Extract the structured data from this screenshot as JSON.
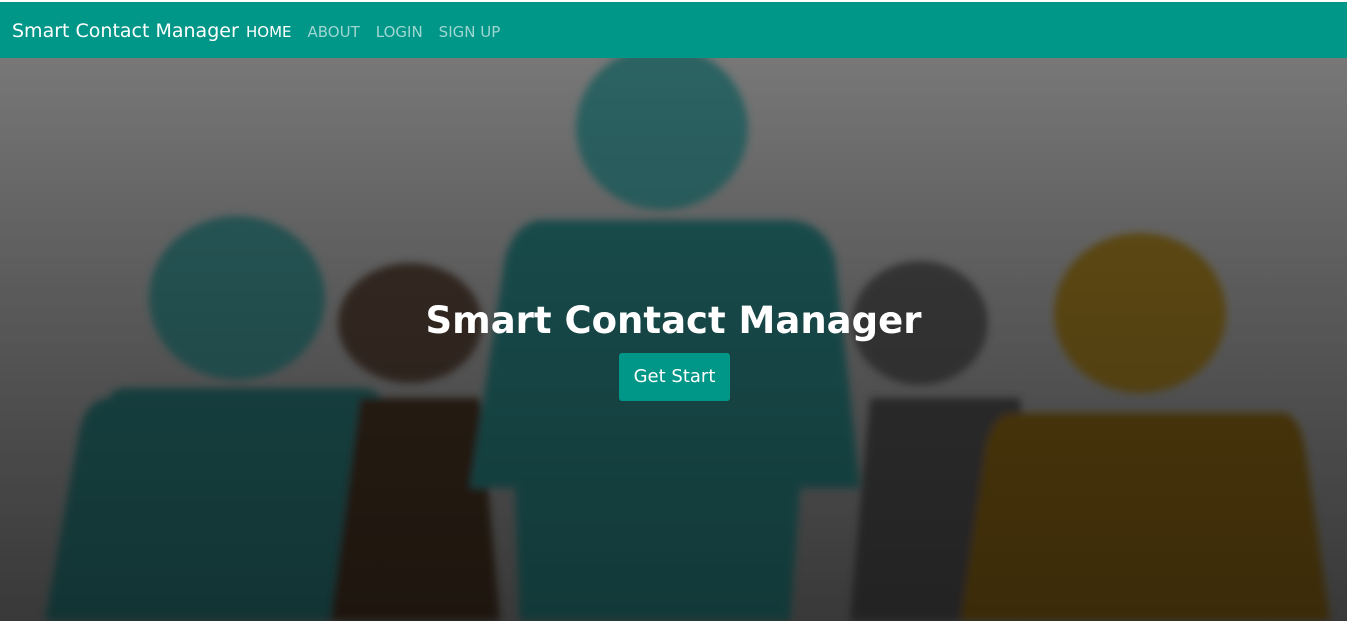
{
  "navbar": {
    "brand": "Smart Contact Manager",
    "links": [
      {
        "label": "HOME",
        "active": true
      },
      {
        "label": "ABOUT",
        "active": false
      },
      {
        "label": "LOGIN",
        "active": false
      },
      {
        "label": "SIGN UP",
        "active": false
      }
    ]
  },
  "hero": {
    "title": "Smart Contact Manager",
    "button_label": "Get Start"
  },
  "colors": {
    "primary": "#009688",
    "teal_figure": "#1f5b5b",
    "brown_figure": "#3a2a22",
    "gray_figure": "#3c3c3c",
    "yellow_figure": "#6b4f10"
  }
}
